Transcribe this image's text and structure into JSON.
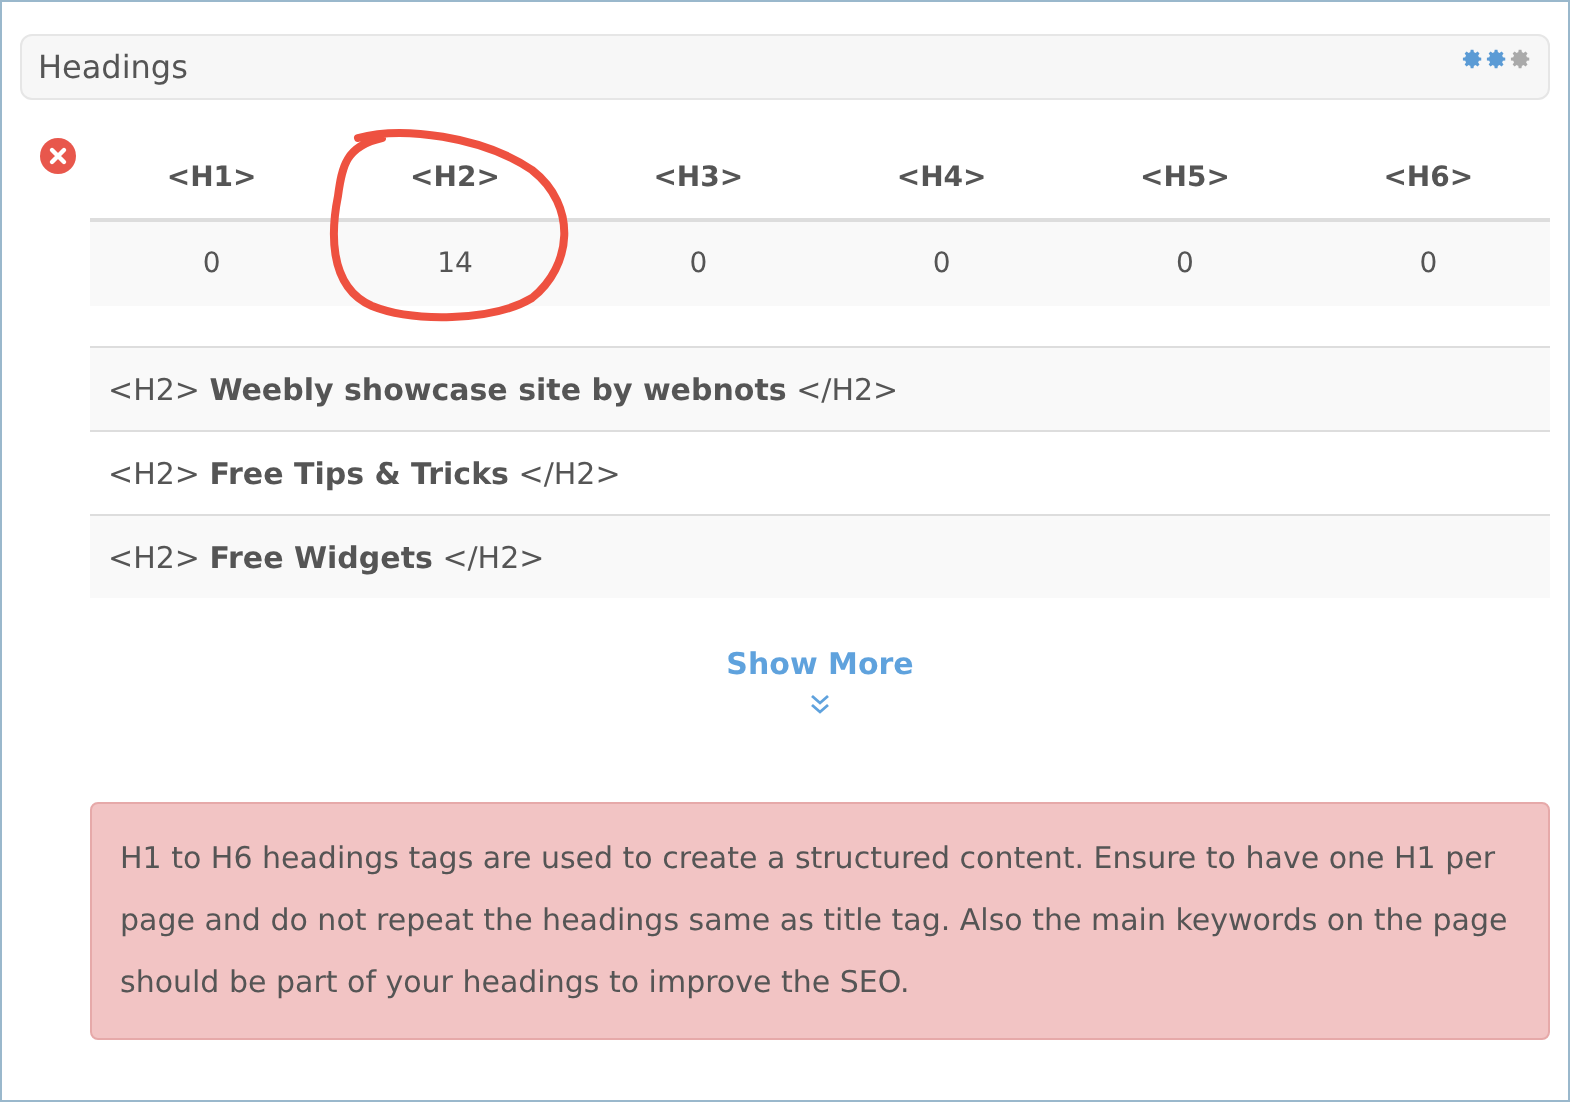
{
  "panel": {
    "title": "Headings"
  },
  "status": {
    "kind": "error"
  },
  "counts": [
    {
      "tag": "<H1>",
      "value": "0"
    },
    {
      "tag": "<H2>",
      "value": "14"
    },
    {
      "tag": "<H3>",
      "value": "0"
    },
    {
      "tag": "<H4>",
      "value": "0"
    },
    {
      "tag": "<H5>",
      "value": "0"
    },
    {
      "tag": "<H6>",
      "value": "0"
    }
  ],
  "headings": [
    "<H2> **Weebly showcase site by webnots** </H2>",
    "<H2> **Free Tips & Tricks** </H2>",
    "<H2> **Free Widgets** </H2>"
  ],
  "show_more": "Show More",
  "alert": "H1 to H6 headings tags are used to create a structured content. Ensure to have one H1 per page and do not repeat the headings same as title tag. Also the main keywords on the page should be part of your headings to improve the SEO."
}
